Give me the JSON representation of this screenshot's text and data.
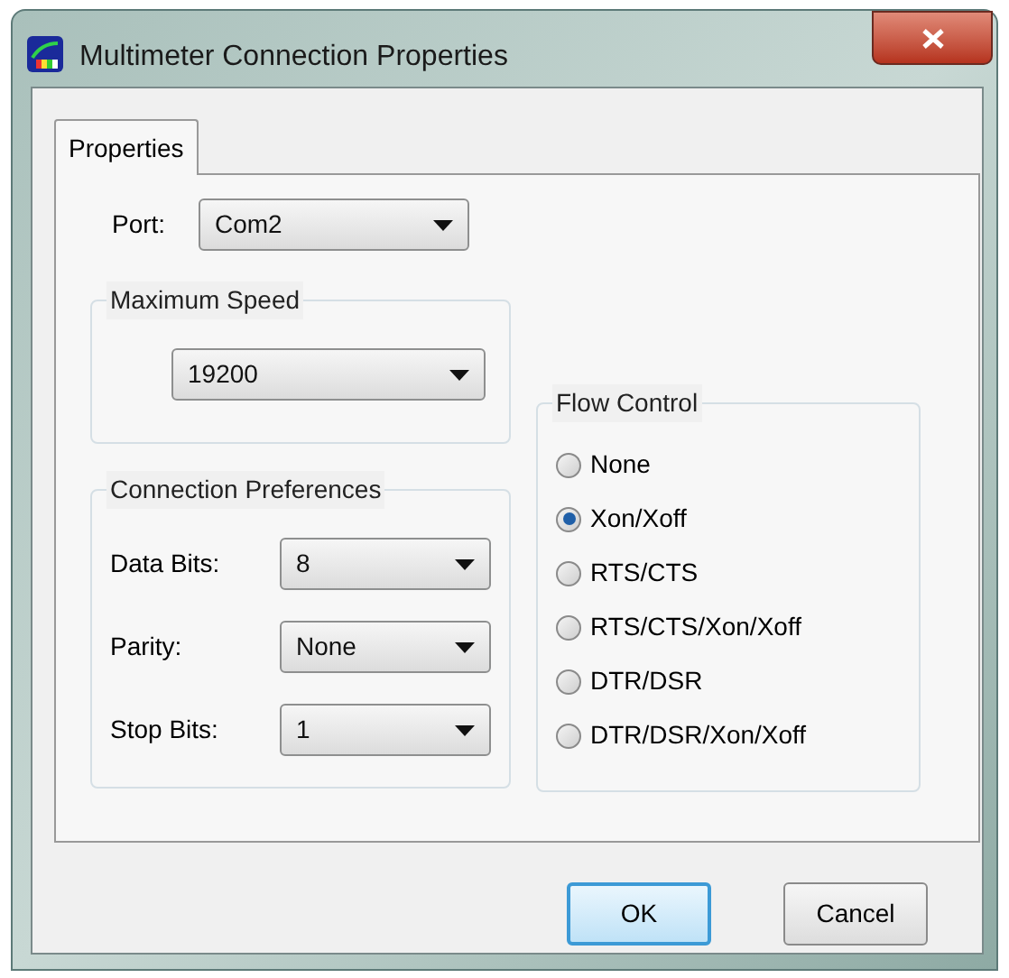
{
  "window": {
    "title": "Multimeter Connection Properties"
  },
  "tabs": [
    {
      "label": "Properties",
      "selected": true
    }
  ],
  "port": {
    "label": "Port:",
    "value": "Com2"
  },
  "maximum_speed": {
    "title": "Maximum Speed",
    "value": "19200"
  },
  "connection_preferences": {
    "title": "Connection Preferences",
    "fields": [
      {
        "label": "Data Bits:",
        "value": "8"
      },
      {
        "label": "Parity:",
        "value": "None"
      },
      {
        "label": "Stop Bits:",
        "value": "1"
      }
    ]
  },
  "flow_control": {
    "title": "Flow Control",
    "options": [
      {
        "label": "None",
        "selected": false
      },
      {
        "label": "Xon/Xoff",
        "selected": true
      },
      {
        "label": "RTS/CTS",
        "selected": false
      },
      {
        "label": "RTS/CTS/Xon/Xoff",
        "selected": false
      },
      {
        "label": "DTR/DSR",
        "selected": false
      },
      {
        "label": "DTR/DSR/Xon/Xoff",
        "selected": false
      }
    ]
  },
  "buttons": [
    {
      "label": "OK",
      "kind": "default"
    },
    {
      "label": "Cancel",
      "kind": "normal"
    }
  ]
}
